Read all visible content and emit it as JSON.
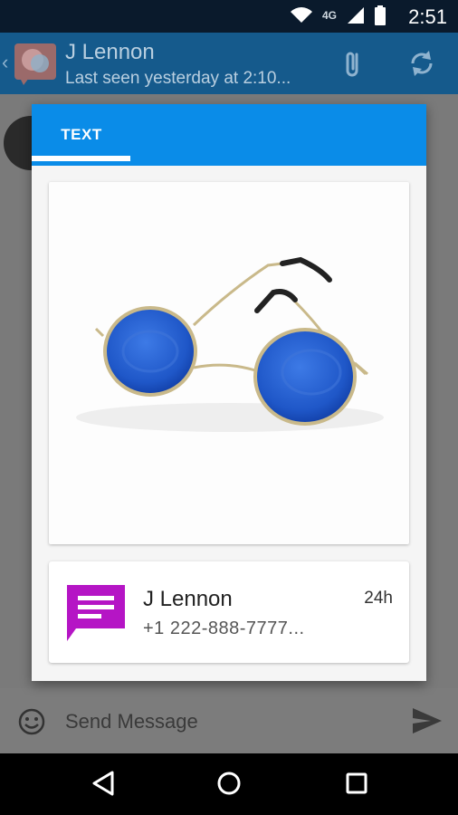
{
  "status_bar": {
    "time": "2:51",
    "network": "4G"
  },
  "conversation": {
    "contact_name": "J Lennon",
    "last_seen": "Last seen yesterday at 2:10..."
  },
  "composer": {
    "placeholder": "Send Message"
  },
  "dialog": {
    "tab_label": "TEXT",
    "contact_card": {
      "name": "J Lennon",
      "number": "+1 222-888-7777...",
      "age": "24h"
    }
  },
  "colors": {
    "tab_blue": "#0a8ce8",
    "app_bar": "#155a8c",
    "message_icon": "#b515c5",
    "lens_blue": "#1f57c8"
  }
}
